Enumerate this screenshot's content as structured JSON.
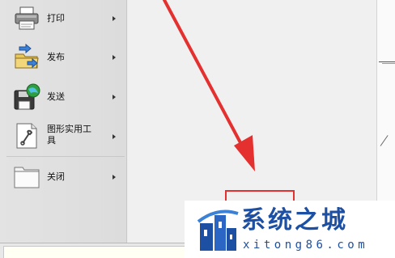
{
  "menu": {
    "items": [
      {
        "label": "打印",
        "icon": "printer-icon"
      },
      {
        "label": "发布",
        "icon": "publish-folder-icon"
      },
      {
        "label": "发送",
        "icon": "send-globe-disk-icon"
      },
      {
        "label": "图形实用工具",
        "icon": "wrench-document-icon"
      },
      {
        "label": "关闭",
        "icon": "folder-close-icon"
      }
    ]
  },
  "annotation": {
    "color": "#e53030"
  },
  "watermark": {
    "title": "系统之城",
    "url": "xitong86.com",
    "color": "#1d4fa3"
  }
}
